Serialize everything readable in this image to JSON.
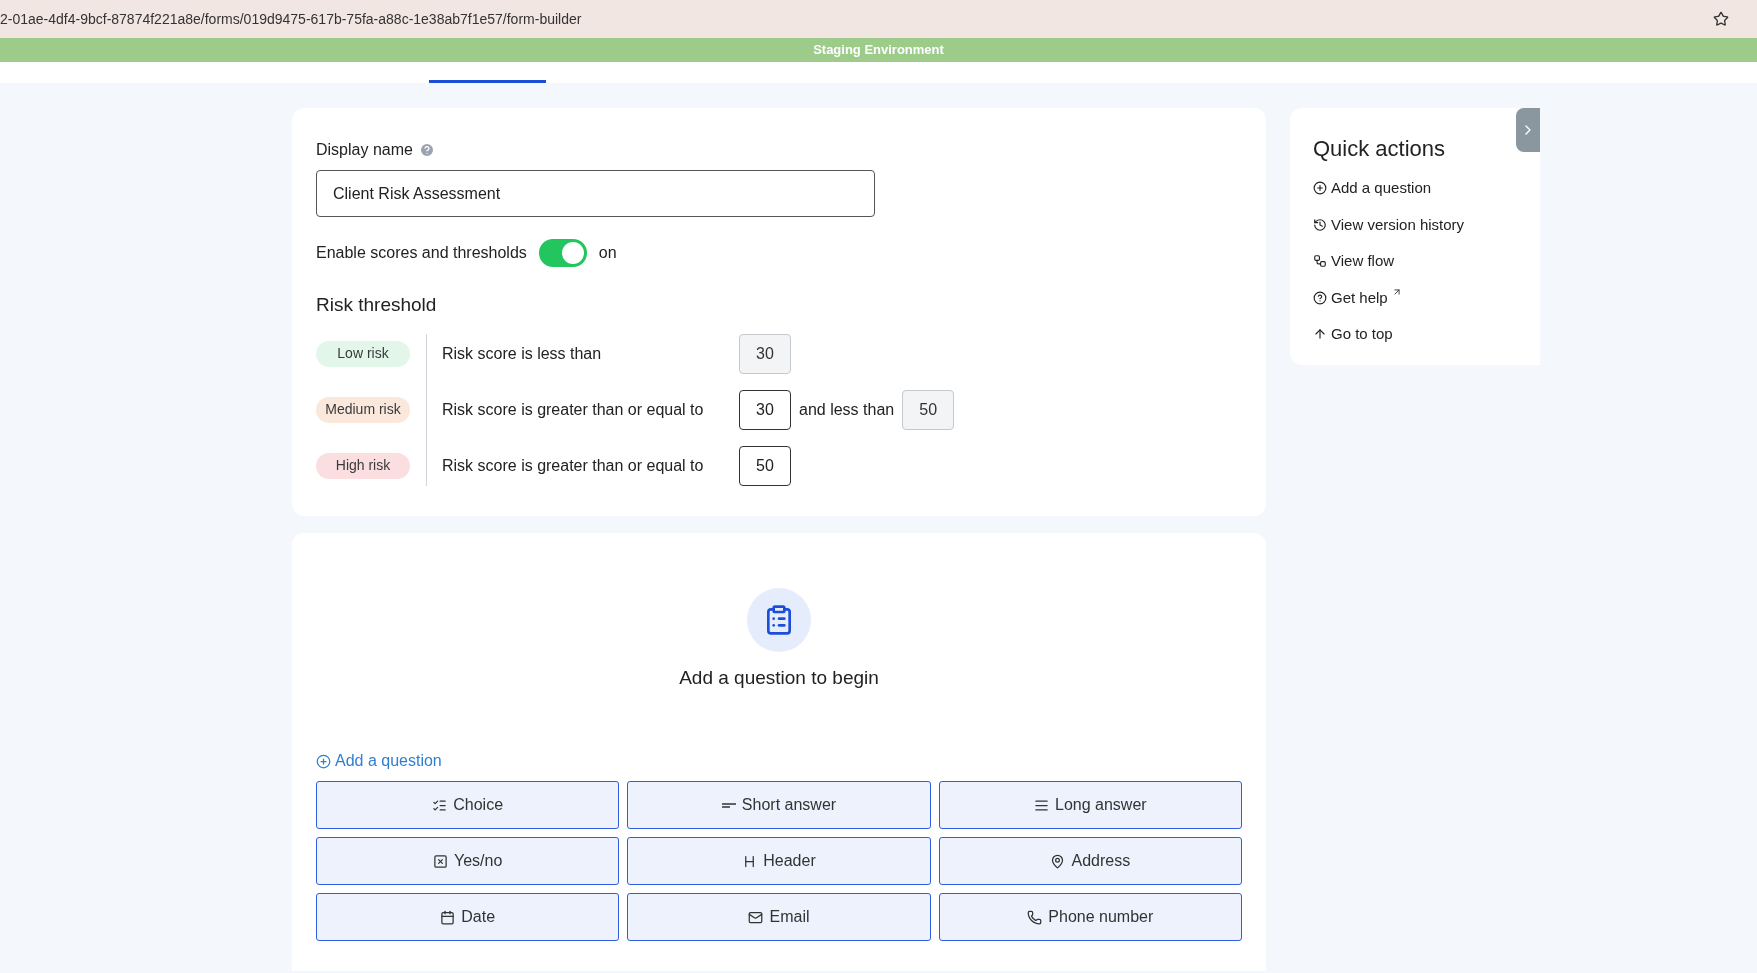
{
  "browser": {
    "url": "2-01ae-4df4-9bcf-87874f221a8e/forms/019d9475-617b-75fa-a88c-1e38ab7f1e57/form-builder"
  },
  "banner": "Staging Environment",
  "form": {
    "display_name_label": "Display name",
    "display_name_value": "Client Risk Assessment",
    "toggle_label": "Enable scores and thresholds",
    "toggle_on": true,
    "toggle_state_text": "on",
    "threshold_title": "Risk threshold",
    "thresholds": [
      {
        "badge": "Low risk",
        "color": "#e2f6ea",
        "condition": "Risk score is less than",
        "first": {
          "value": "30",
          "disabled": true
        }
      },
      {
        "badge": "Medium risk",
        "color": "#fbe8dd",
        "condition": "Risk score is greater than or equal to",
        "first": {
          "value": "30",
          "disabled": false
        },
        "connector": "and less than",
        "second": {
          "value": "50",
          "disabled": true
        }
      },
      {
        "badge": "High risk",
        "color": "#fbdfe0",
        "condition": "Risk score is greater than or equal to",
        "first": {
          "value": "50",
          "disabled": false
        }
      }
    ]
  },
  "empty_state": {
    "title": "Add a question to begin",
    "add_link": "Add a question",
    "question_types": [
      {
        "label": "Choice",
        "kind": "choice"
      },
      {
        "label": "Short answer",
        "kind": "short"
      },
      {
        "label": "Long answer",
        "kind": "long"
      },
      {
        "label": "Yes/no",
        "kind": "yesno"
      },
      {
        "label": "Header",
        "kind": "header"
      },
      {
        "label": "Address",
        "kind": "address"
      },
      {
        "label": "Date",
        "kind": "date"
      },
      {
        "label": "Email",
        "kind": "email"
      },
      {
        "label": "Phone number",
        "kind": "phone"
      }
    ]
  },
  "quick_actions": {
    "title": "Quick actions",
    "items": [
      {
        "label": "Add a question",
        "kind": "add"
      },
      {
        "label": "View version history",
        "kind": "history"
      },
      {
        "label": "View flow",
        "kind": "flow"
      },
      {
        "label": "Get help",
        "kind": "help"
      },
      {
        "label": "Go to top",
        "kind": "top"
      }
    ]
  }
}
